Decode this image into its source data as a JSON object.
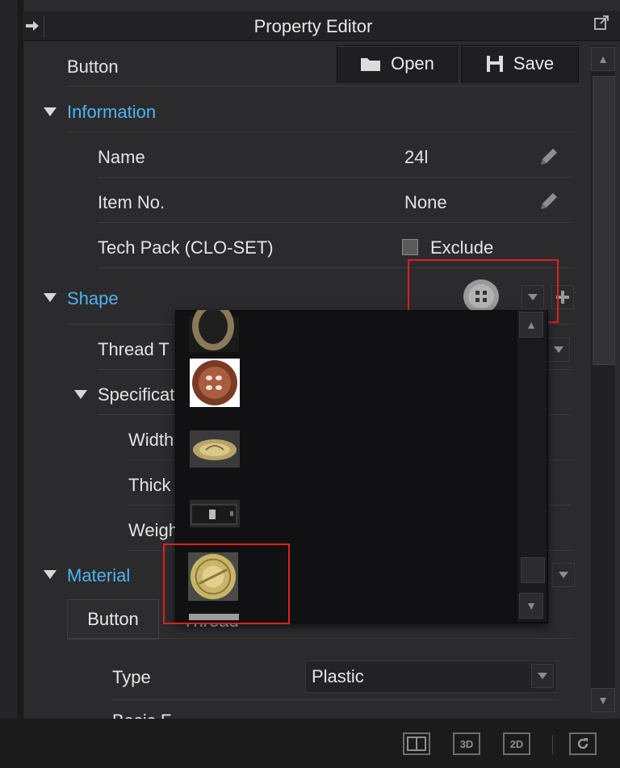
{
  "window": {
    "title": "Property Editor"
  },
  "toolbar": {
    "category_label": "Button",
    "open_label": "Open",
    "save_label": "Save"
  },
  "information": {
    "header": "Information",
    "rows": [
      {
        "label": "Name",
        "value": "24l"
      },
      {
        "label": "Item No.",
        "value": "None"
      }
    ],
    "techpack": {
      "label": "Tech Pack (CLO-SET)",
      "checkbox_label": "Exclude"
    }
  },
  "shape": {
    "header": "Shape",
    "thread_label": "Thread T",
    "specification": {
      "header": "Specificat",
      "rows": [
        "Width",
        "Thick",
        "Weigh"
      ]
    }
  },
  "material": {
    "header": "Material",
    "tabs": [
      "Button",
      "Thread"
    ],
    "type_label": "Type",
    "type_value": "Plastic",
    "next_label": "Basic F"
  },
  "bottom_toolbar": {
    "view_3d": "3D",
    "view_2d": "2D"
  },
  "colors": {
    "accent": "#4fb3ef",
    "highlight": "#e02020"
  }
}
